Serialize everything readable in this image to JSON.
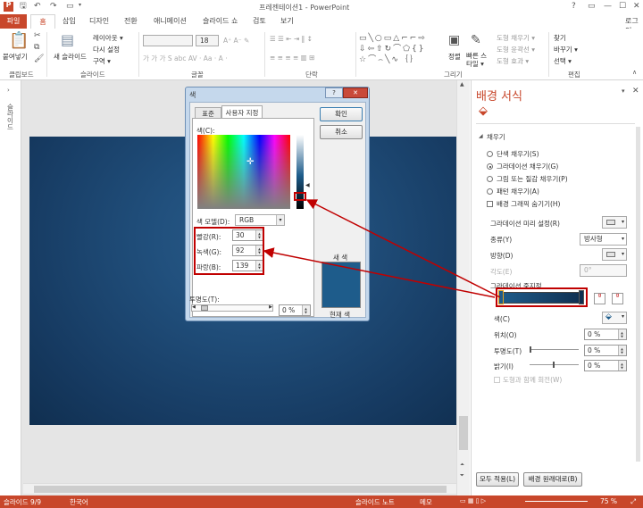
{
  "window": {
    "title": "프레젠테이션1 - PowerPoint",
    "login": "로그인",
    "controls": [
      "?",
      "▭",
      "—",
      "☐",
      "✕"
    ]
  },
  "ribbon_tabs": {
    "file": "파일",
    "home": "홈",
    "insert": "삽입",
    "design": "디자인",
    "transitions": "전환",
    "animations": "애니메이션",
    "slideshow": "슬라이드 쇼",
    "review": "검토",
    "view": "보기"
  },
  "ribbon": {
    "clipboard": {
      "paste": "붙여넣기",
      "label": "클립보드"
    },
    "slides": {
      "new_slide": "새 슬라이드",
      "layout": "레이아웃 ▾",
      "reset": "다시 설정",
      "section": "구역 ▾",
      "label": "슬라이드"
    },
    "font": {
      "size": "18",
      "label": "글꼴"
    },
    "paragraph": {
      "label": "단락"
    },
    "drawing": {
      "arrange": "정렬",
      "quick_styles": "빠른 스타일 ▾",
      "fill": "도형 채우기 ▾",
      "outline": "도형 윤곽선 ▾",
      "effects": "도형 효과 ▾",
      "label": "그리기"
    },
    "editing": {
      "find": "찾기",
      "replace": "바꾸기 ▾",
      "select": "선택 ▾",
      "label": "편집"
    }
  },
  "left_strip": {
    "label": "슬라이드"
  },
  "dialog": {
    "title": "색",
    "help": "?",
    "close": "✕",
    "tab_standard": "표준",
    "tab_custom": "사용자 지정",
    "ok": "확인",
    "cancel": "취소",
    "colors_label": "색(C):",
    "color_model_label": "색 모델(D):",
    "color_model": "RGB",
    "red_label": "빨강(R):",
    "green_label": "녹색(G):",
    "blue_label": "파랑(B):",
    "red": "30",
    "green": "92",
    "blue": "139",
    "transparency_label": "투명도(T):",
    "transparency": "0 %",
    "new_label": "새 색",
    "current_label": "현재 색",
    "new_color": "#1e5c8b",
    "current_color": "#1e5c8b"
  },
  "pane": {
    "title": "배경 서식",
    "section": "채우기",
    "opt_solid": "단색 채우기(S)",
    "opt_gradient": "그라데이션 채우기(G)",
    "opt_picture": "그림 또는 질감 채우기(P)",
    "opt_pattern": "패턴 채우기(A)",
    "hide_graphics": "배경 그래픽 숨기기(H)",
    "preset_label": "그라데이션 미리 설정(R)",
    "type_label": "종류(Y)",
    "type_value": "방사형",
    "direction_label": "방향(D)",
    "angle_label": "각도(E)",
    "angle_value": "0°",
    "stops_label": "그라데이션 중지점",
    "color_label": "색(C)",
    "position_label": "위치(O)",
    "position_value": "0 %",
    "transparency_label": "투명도(T)",
    "transparency_value": "0 %",
    "brightness_label": "밝기(I)",
    "brightness_value": "0 %",
    "rotate_label": "도형과 함께 회전(W)",
    "apply_all": "모두 적용(L)",
    "reset_bg": "배경 원래대로(B)"
  },
  "status": {
    "slide": "슬라이드 9/9",
    "lang": "한국어",
    "notes": "슬라이드 노트",
    "comments": "메모",
    "zoom": "75 %"
  },
  "colors": {
    "accent": "#c8472b",
    "annotation": "#c00000",
    "slide_bg": "#1e5c8b"
  }
}
